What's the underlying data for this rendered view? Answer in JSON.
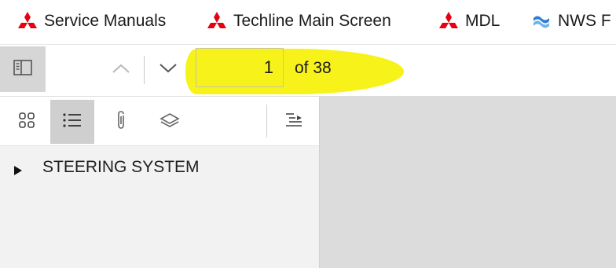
{
  "bookmarks": [
    {
      "label": "Service Manuals",
      "icon": "mitsubishi-logo-icon"
    },
    {
      "label": "Techline Main Screen",
      "icon": "mitsubishi-logo-icon"
    },
    {
      "label": "MDL",
      "icon": "mitsubishi-logo-icon"
    },
    {
      "label": "NWS F",
      "icon": "nws-logo-icon"
    }
  ],
  "toolbar": {
    "page_current": "1",
    "page_total_label": "of 38"
  },
  "panel": {
    "tabs": [
      "thumbnails",
      "outline",
      "attachments",
      "layers"
    ],
    "active_tab": "outline",
    "tree": [
      {
        "label": "STEERING SYSTEM",
        "expanded": false
      }
    ]
  },
  "colors": {
    "highlight": "#f6f21a",
    "logo_red": "#e60012",
    "nws_blue": "#2a7fd4"
  }
}
